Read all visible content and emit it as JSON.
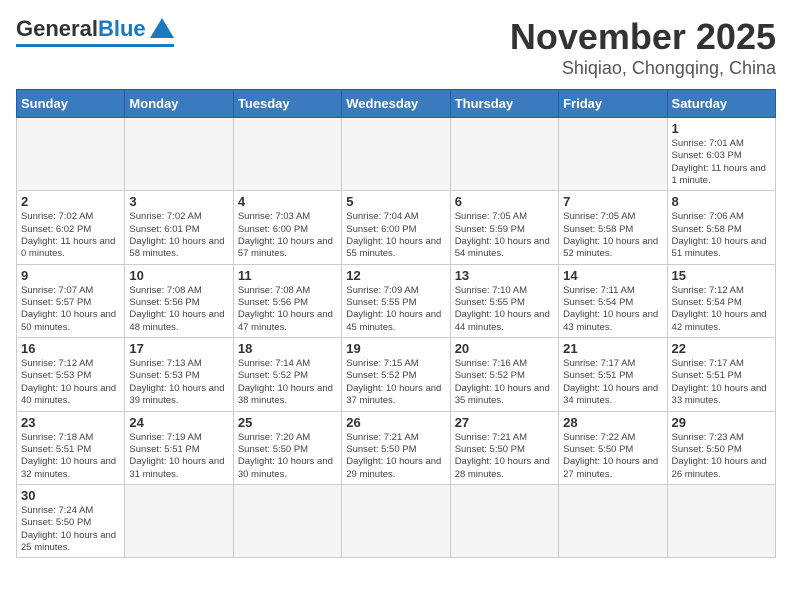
{
  "logo": {
    "general": "General",
    "blue": "Blue"
  },
  "header": {
    "month": "November 2025",
    "location": "Shiqiao, Chongqing, China"
  },
  "weekdays": [
    "Sunday",
    "Monday",
    "Tuesday",
    "Wednesday",
    "Thursday",
    "Friday",
    "Saturday"
  ],
  "weeks": [
    [
      {
        "day": "",
        "info": ""
      },
      {
        "day": "",
        "info": ""
      },
      {
        "day": "",
        "info": ""
      },
      {
        "day": "",
        "info": ""
      },
      {
        "day": "",
        "info": ""
      },
      {
        "day": "",
        "info": ""
      },
      {
        "day": "1",
        "info": "Sunrise: 7:01 AM\nSunset: 6:03 PM\nDaylight: 11 hours\nand 1 minute."
      }
    ],
    [
      {
        "day": "2",
        "info": "Sunrise: 7:02 AM\nSunset: 6:02 PM\nDaylight: 11 hours\nand 0 minutes."
      },
      {
        "day": "3",
        "info": "Sunrise: 7:02 AM\nSunset: 6:01 PM\nDaylight: 10 hours\nand 58 minutes."
      },
      {
        "day": "4",
        "info": "Sunrise: 7:03 AM\nSunset: 6:00 PM\nDaylight: 10 hours\nand 57 minutes."
      },
      {
        "day": "5",
        "info": "Sunrise: 7:04 AM\nSunset: 6:00 PM\nDaylight: 10 hours\nand 55 minutes."
      },
      {
        "day": "6",
        "info": "Sunrise: 7:05 AM\nSunset: 5:59 PM\nDaylight: 10 hours\nand 54 minutes."
      },
      {
        "day": "7",
        "info": "Sunrise: 7:05 AM\nSunset: 5:58 PM\nDaylight: 10 hours\nand 52 minutes."
      },
      {
        "day": "8",
        "info": "Sunrise: 7:06 AM\nSunset: 5:58 PM\nDaylight: 10 hours\nand 51 minutes."
      }
    ],
    [
      {
        "day": "9",
        "info": "Sunrise: 7:07 AM\nSunset: 5:57 PM\nDaylight: 10 hours\nand 50 minutes."
      },
      {
        "day": "10",
        "info": "Sunrise: 7:08 AM\nSunset: 5:56 PM\nDaylight: 10 hours\nand 48 minutes."
      },
      {
        "day": "11",
        "info": "Sunrise: 7:08 AM\nSunset: 5:56 PM\nDaylight: 10 hours\nand 47 minutes."
      },
      {
        "day": "12",
        "info": "Sunrise: 7:09 AM\nSunset: 5:55 PM\nDaylight: 10 hours\nand 45 minutes."
      },
      {
        "day": "13",
        "info": "Sunrise: 7:10 AM\nSunset: 5:55 PM\nDaylight: 10 hours\nand 44 minutes."
      },
      {
        "day": "14",
        "info": "Sunrise: 7:11 AM\nSunset: 5:54 PM\nDaylight: 10 hours\nand 43 minutes."
      },
      {
        "day": "15",
        "info": "Sunrise: 7:12 AM\nSunset: 5:54 PM\nDaylight: 10 hours\nand 42 minutes."
      }
    ],
    [
      {
        "day": "16",
        "info": "Sunrise: 7:12 AM\nSunset: 5:53 PM\nDaylight: 10 hours\nand 40 minutes."
      },
      {
        "day": "17",
        "info": "Sunrise: 7:13 AM\nSunset: 5:53 PM\nDaylight: 10 hours\nand 39 minutes."
      },
      {
        "day": "18",
        "info": "Sunrise: 7:14 AM\nSunset: 5:52 PM\nDaylight: 10 hours\nand 38 minutes."
      },
      {
        "day": "19",
        "info": "Sunrise: 7:15 AM\nSunset: 5:52 PM\nDaylight: 10 hours\nand 37 minutes."
      },
      {
        "day": "20",
        "info": "Sunrise: 7:16 AM\nSunset: 5:52 PM\nDaylight: 10 hours\nand 35 minutes."
      },
      {
        "day": "21",
        "info": "Sunrise: 7:17 AM\nSunset: 5:51 PM\nDaylight: 10 hours\nand 34 minutes."
      },
      {
        "day": "22",
        "info": "Sunrise: 7:17 AM\nSunset: 5:51 PM\nDaylight: 10 hours\nand 33 minutes."
      }
    ],
    [
      {
        "day": "23",
        "info": "Sunrise: 7:18 AM\nSunset: 5:51 PM\nDaylight: 10 hours\nand 32 minutes."
      },
      {
        "day": "24",
        "info": "Sunrise: 7:19 AM\nSunset: 5:51 PM\nDaylight: 10 hours\nand 31 minutes."
      },
      {
        "day": "25",
        "info": "Sunrise: 7:20 AM\nSunset: 5:50 PM\nDaylight: 10 hours\nand 30 minutes."
      },
      {
        "day": "26",
        "info": "Sunrise: 7:21 AM\nSunset: 5:50 PM\nDaylight: 10 hours\nand 29 minutes."
      },
      {
        "day": "27",
        "info": "Sunrise: 7:21 AM\nSunset: 5:50 PM\nDaylight: 10 hours\nand 28 minutes."
      },
      {
        "day": "28",
        "info": "Sunrise: 7:22 AM\nSunset: 5:50 PM\nDaylight: 10 hours\nand 27 minutes."
      },
      {
        "day": "29",
        "info": "Sunrise: 7:23 AM\nSunset: 5:50 PM\nDaylight: 10 hours\nand 26 minutes."
      }
    ],
    [
      {
        "day": "30",
        "info": "Sunrise: 7:24 AM\nSunset: 5:50 PM\nDaylight: 10 hours\nand 25 minutes."
      },
      {
        "day": "",
        "info": ""
      },
      {
        "day": "",
        "info": ""
      },
      {
        "day": "",
        "info": ""
      },
      {
        "day": "",
        "info": ""
      },
      {
        "day": "",
        "info": ""
      },
      {
        "day": "",
        "info": ""
      }
    ]
  ]
}
